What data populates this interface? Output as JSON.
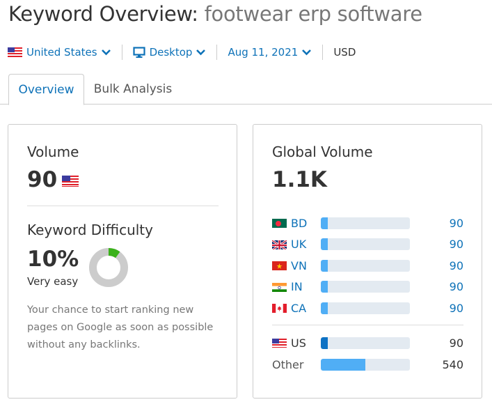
{
  "header": {
    "title_prefix": "Keyword Overview:",
    "keyword": "footwear erp software"
  },
  "filters": {
    "country": {
      "label": "United States",
      "flag": "us-flag-icon"
    },
    "device": {
      "label": "Desktop",
      "icon": "desktop-icon"
    },
    "date": {
      "label": "Aug 11, 2021"
    },
    "currency": "USD"
  },
  "tabs": [
    {
      "label": "Overview",
      "active": true
    },
    {
      "label": "Bulk Analysis",
      "active": false
    }
  ],
  "volume": {
    "label": "Volume",
    "value": "90",
    "flag": "us-flag-icon"
  },
  "keyword_difficulty": {
    "label": "Keyword Difficulty",
    "value": "10%",
    "percent": 10,
    "rating": "Very easy",
    "description": "Your chance to start ranking new pages on Google as soon as possible without any backlinks.",
    "colors": {
      "fill": "#3ab11a",
      "track": "#cccccc"
    }
  },
  "global_volume": {
    "label": "Global Volume",
    "value": "1.1K",
    "countries": [
      {
        "code": "BD",
        "value": "90",
        "fill_percent": 8
      },
      {
        "code": "UK",
        "value": "90",
        "fill_percent": 8
      },
      {
        "code": "VN",
        "value": "90",
        "fill_percent": 8
      },
      {
        "code": "IN",
        "value": "90",
        "fill_percent": 8
      },
      {
        "code": "CA",
        "value": "90",
        "fill_percent": 8
      }
    ],
    "us": {
      "code": "US",
      "value": "90",
      "fill_percent": 8
    },
    "other": {
      "label": "Other",
      "value": "540",
      "fill_percent": 50
    },
    "colors": {
      "bar": "#50aef5",
      "us_bar": "#0e72c4",
      "track": "#e3eaf1",
      "link": "#0e72b8"
    }
  }
}
